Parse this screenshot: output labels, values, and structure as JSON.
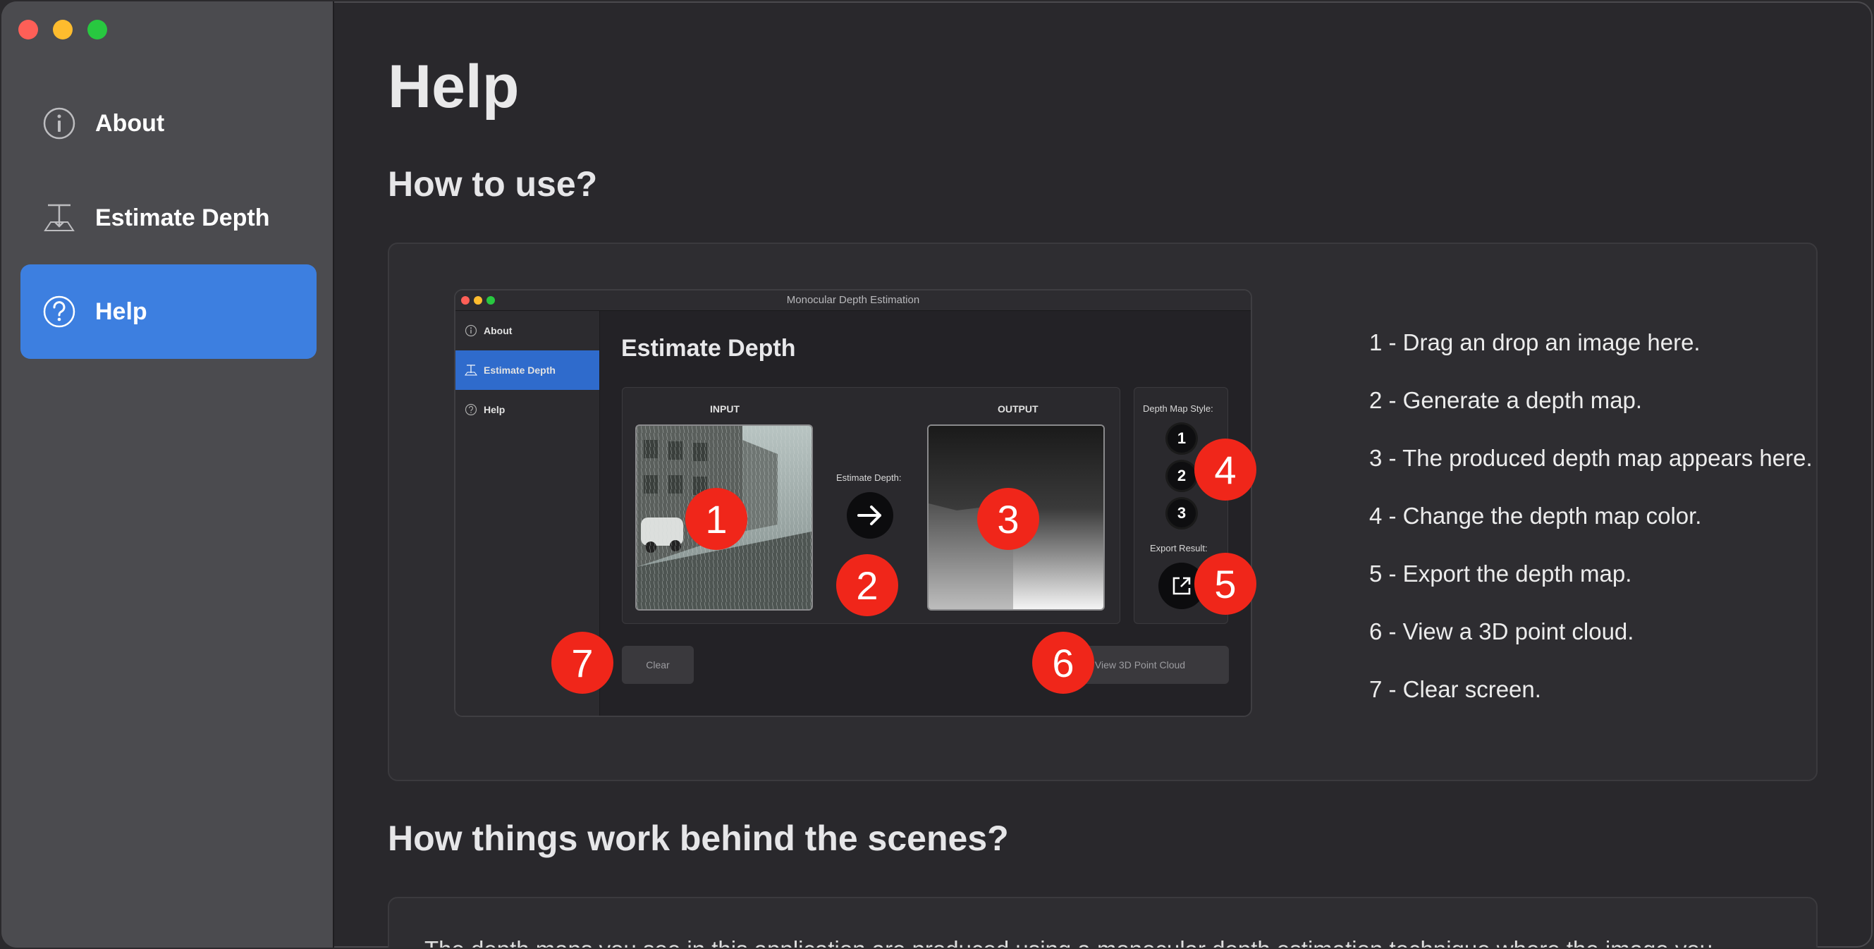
{
  "sidebar": {
    "items": [
      {
        "label": "About",
        "icon": "info-circle-icon"
      },
      {
        "label": "Estimate Depth",
        "icon": "depth-tool-icon"
      },
      {
        "label": "Help",
        "icon": "question-circle-icon",
        "active": true
      }
    ]
  },
  "main": {
    "title": "Help",
    "how_to_use": {
      "heading": "How to use?",
      "steps": [
        "1 - Drag an drop an image here.",
        "2 - Generate a depth map.",
        "3 - The produced depth map appears here.",
        "4 - Change the depth map color.",
        "5 - Export the depth map.",
        "6 - View a 3D point cloud.",
        "7 - Clear screen."
      ],
      "screenshot": {
        "window_title": "Monocular Depth Estimation",
        "sidebar": [
          "About",
          "Estimate Depth",
          "Help"
        ],
        "heading": "Estimate Depth",
        "input_label": "INPUT",
        "output_label": "OUTPUT",
        "estimate_label": "Estimate Depth:",
        "style_label": "Depth Map Style:",
        "styles": [
          "1",
          "2",
          "3"
        ],
        "export_label": "Export Result:",
        "clear_button": "Clear",
        "point_cloud_button": "View 3D Point Cloud"
      },
      "badges": [
        "1",
        "2",
        "3",
        "4",
        "5",
        "6",
        "7"
      ]
    },
    "behind_scenes": {
      "heading": "How things work behind the scenes?",
      "text": "The depth maps you see in this application are produced using a monocular depth estimation technique where the image you"
    }
  },
  "colors": {
    "accent": "#3d7fe0",
    "badge": "#f0261a",
    "sidebar_bg": "#4b4b4f",
    "main_bg": "#29282c"
  }
}
